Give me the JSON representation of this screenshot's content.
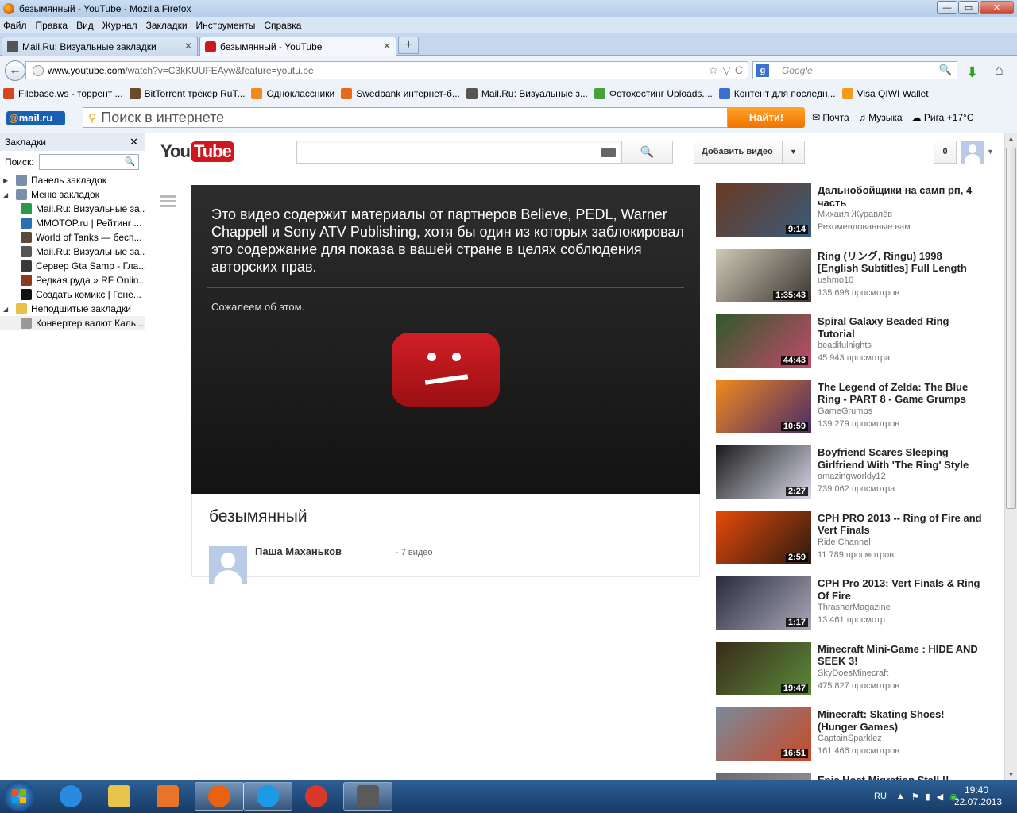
{
  "window": {
    "title": "безымянный - YouTube - Mozilla Firefox",
    "min": "—",
    "max": "▭",
    "close": "✕"
  },
  "menu": [
    "Файл",
    "Правка",
    "Вид",
    "Журнал",
    "Закладки",
    "Инструменты",
    "Справка"
  ],
  "tabs": [
    {
      "label": "Mail.Ru: Визуальные закладки",
      "close": "✕"
    },
    {
      "label": "безымянный - YouTube",
      "close": "✕"
    }
  ],
  "newtab": "+",
  "nav": {
    "back": "←",
    "url_host": "www.youtube.com",
    "url_rest": "/watch?v=C3kKUUFEAyw&feature=youtu.be",
    "star": "☆",
    "dropdown": "▽",
    "reload": "C",
    "search_engine": "g",
    "search_placeholder": "Google",
    "search_icon": "🔍",
    "download_icon": "⬇",
    "home_icon": "⌂"
  },
  "bookmarks": [
    {
      "label": "Filebase.ws - торрент ...",
      "color": "#d94422"
    },
    {
      "label": "BitTorrent трекер RuT...",
      "color": "#6b4c2a"
    },
    {
      "label": "Одноклассники",
      "color": "#f08a1c"
    },
    {
      "label": "Swedbank интернет-б...",
      "color": "#e46b1a"
    },
    {
      "label": "Mail.Ru: Визуальные з...",
      "color": "#555555"
    },
    {
      "label": "Фотохостинг Uploads....",
      "color": "#48a23a"
    },
    {
      "label": "Контент для последн...",
      "color": "#3b6fd0"
    },
    {
      "label": "Visa QIWI Wallet",
      "color": "#f29b1f"
    }
  ],
  "mailbar": {
    "logo_at": "@",
    "logo_text": "mail.ru",
    "search_placeholder": "Поиск в интернете",
    "find_button": "Найти!",
    "links": [
      "Почта",
      "Музыка",
      "Рига +17°C"
    ]
  },
  "sidebar": {
    "title": "Закладки",
    "close": "✕",
    "search_label": "Поиск:",
    "search_icon": "🔍",
    "tree": [
      {
        "label": "Панель закладок",
        "level": 0,
        "arrow": "▶",
        "color": "#7b8fa8"
      },
      {
        "label": "Меню закладок",
        "level": 0,
        "arrow": "◢",
        "color": "#7b8fa8"
      },
      {
        "label": "Mail.Ru: Визуальные за...",
        "level": 1,
        "color": "#2a9a4a"
      },
      {
        "label": "MMOTOP.ru | Рейтинг ...",
        "level": 1,
        "color": "#2a6fb4"
      },
      {
        "label": "World of Tanks — бесп...",
        "level": 1,
        "color": "#5a4a3a"
      },
      {
        "label": "Mail.Ru: Визуальные за...",
        "level": 1,
        "color": "#555555"
      },
      {
        "label": "Сервер Gta Samp - Гла...",
        "level": 1,
        "color": "#3a3a3a"
      },
      {
        "label": "Редкая руда » RF Onlin...",
        "level": 1,
        "color": "#8a3a1a"
      },
      {
        "label": "Создать комикс | Гене...",
        "level": 1,
        "color": "#111111"
      },
      {
        "label": "Неподшитые закладки",
        "level": 0,
        "arrow": "◢",
        "color": "#e8c24a"
      },
      {
        "label": "Конвертер валют Каль...",
        "level": 1,
        "color": "#999999"
      }
    ]
  },
  "youtube": {
    "logo_you": "You",
    "logo_tube": "Tube",
    "search_icon": "🔍",
    "upload_label": "Добавить видео",
    "upload_arrow": "▼",
    "notif_count": "0",
    "avatar_arrow": "▼",
    "player": {
      "message": "Это видео содержит материалы от партнеров Believe, PEDL, Warner Chappell и Sony ATV Publishing, хотя бы один из которых заблокировал это содержание для показа в вашей стране в целях соблюдения авторских прав.",
      "sorry": "Сожалеем об этом."
    },
    "video": {
      "title": "безымянный",
      "owner": "Паша Маханьков",
      "count": "· 7 видео"
    },
    "related": [
      {
        "title": "Дальнобойщики на самп рп, 4 часть",
        "channel": "Михаил Журавлёв",
        "views": "Рекомендованные вам",
        "duration": "9:14",
        "colors": [
          "#6a3a22",
          "#3a5a7a"
        ]
      },
      {
        "title": "Ring (リング, Ringu) 1998 [English Subtitles] Full Length",
        "channel": "ushmo10",
        "views": "135 698 просмотров",
        "duration": "1:35:43",
        "colors": [
          "#cfc9b8",
          "#3a3630"
        ]
      },
      {
        "title": "Spiral Galaxy Beaded Ring Tutorial",
        "channel": "beadifulnights",
        "views": "45 943 просмотра",
        "duration": "44:43",
        "colors": [
          "#2f5a2a",
          "#c24a6a"
        ]
      },
      {
        "title": "The Legend of Zelda: The Blue Ring - PART 8 - Game Grumps",
        "channel": "GameGrumps",
        "views": "139 279 просмотров",
        "duration": "10:59",
        "colors": [
          "#f08a1c",
          "#4a2a6a"
        ]
      },
      {
        "title": "Boyfriend Scares Sleeping Girlfriend With 'The Ring' Style",
        "channel": "amazingworldy12",
        "views": "739 062 просмотра",
        "duration": "2:27",
        "colors": [
          "#1a1a1a",
          "#d8d8e8"
        ]
      },
      {
        "title": "CPH PRO 2013 -- Ring of Fire and Vert Finals",
        "channel": "Ride Channel",
        "views": "11 789 просмотров",
        "duration": "2:59",
        "colors": [
          "#e84a0a",
          "#2a1a10"
        ]
      },
      {
        "title": "CPH Pro 2013: Vert Finals & Ring Of Fire",
        "channel": "ThrasherMagazine",
        "views": "13 461 просмотр",
        "duration": "1:17",
        "colors": [
          "#2a2a3a",
          "#a8a8b8"
        ]
      },
      {
        "title": "Minecraft Mini-Game : HIDE AND SEEK 3!",
        "channel": "SkyDoesMinecraft",
        "views": "475 827 просмотров",
        "duration": "19:47",
        "colors": [
          "#3a2a1a",
          "#5a8a3a"
        ]
      },
      {
        "title": "Minecraft: Skating Shoes! (Hunger Games)",
        "channel": "CaptainSparklez",
        "views": "161 466 просмотров",
        "duration": "16:51",
        "colors": [
          "#7a8a9a",
          "#c84a2a"
        ]
      },
      {
        "title": "Epic Host Migration Stall !!",
        "channel": "",
        "views": "",
        "duration": "",
        "colors": [
          "#6a6a6a",
          "#9a9a9a"
        ]
      }
    ]
  },
  "taskbar": {
    "apps": [
      {
        "name": "ie",
        "color": "#2a8ae0"
      },
      {
        "name": "explorer",
        "color": "#e8c44a"
      },
      {
        "name": "media-player",
        "color": "#e8742a"
      },
      {
        "name": "firefox",
        "color": "#e8620f"
      },
      {
        "name": "skype",
        "color": "#1a9ae8"
      },
      {
        "name": "chrome",
        "color": "#d8382a"
      },
      {
        "name": "counter-strike",
        "color": "#5a5a5a"
      }
    ],
    "lang": "RU",
    "clock_time": "19:40",
    "clock_date": "22.07.2013"
  },
  "colors": {
    "youtube_red": "#cc181e",
    "mail_orange": "#f07400",
    "mail_blue": "#1a5fb4"
  }
}
